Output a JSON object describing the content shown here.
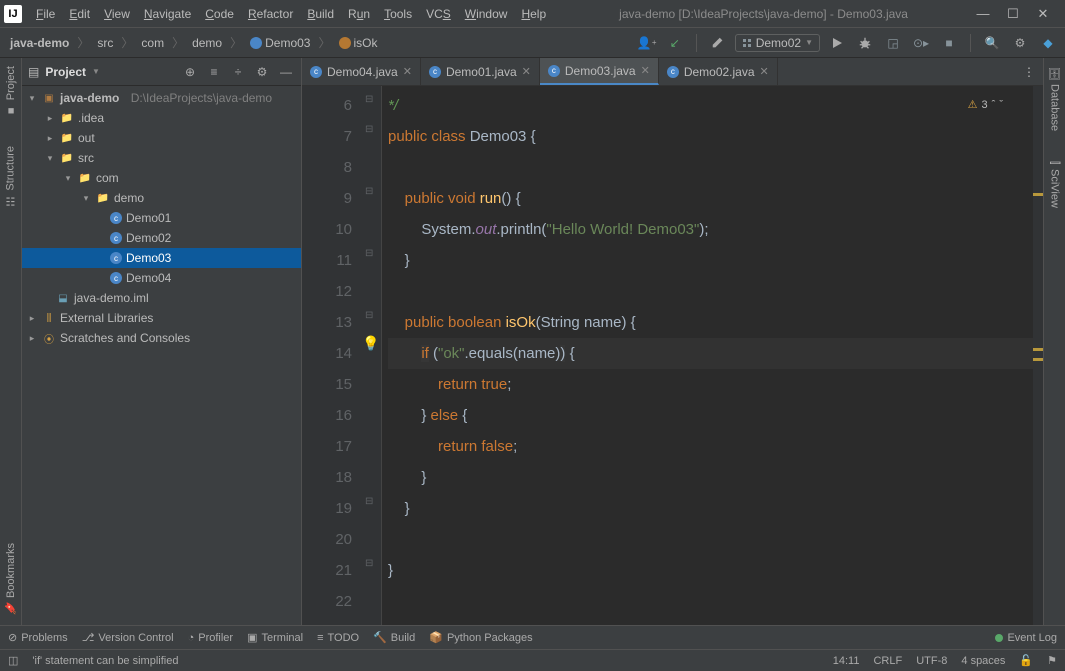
{
  "title": "java-demo [D:\\IdeaProjects\\java-demo] - Demo03.java",
  "menubar": [
    "File",
    "Edit",
    "View",
    "Navigate",
    "Code",
    "Refactor",
    "Build",
    "Run",
    "Tools",
    "VCS",
    "Window",
    "Help"
  ],
  "breadcrumb": {
    "c0": "java-demo",
    "c1": "src",
    "c2": "com",
    "c3": "demo",
    "c4": "Demo03",
    "c5": "isOk"
  },
  "run_config": "Demo02",
  "panel": {
    "title": "Project"
  },
  "tree": {
    "root": "java-demo",
    "root_path": "D:\\IdeaProjects\\java-demo",
    "idea": ".idea",
    "out": "out",
    "src": "src",
    "com": "com",
    "demo": "demo",
    "d1": "Demo01",
    "d2": "Demo02",
    "d3": "Demo03",
    "d4": "Demo04",
    "iml": "java-demo.iml",
    "ext": "External Libraries",
    "scratch": "Scratches and Consoles"
  },
  "tabs": {
    "t0": "Demo04.java",
    "t1": "Demo01.java",
    "t2": "Demo03.java",
    "t3": "Demo02.java"
  },
  "warn_count": "3",
  "code": {
    "l6": "*/",
    "l7_kw1": "public ",
    "l7_kw2": "class ",
    "l7_cls": "Demo03 ",
    "l7_br": "{",
    "l9_kw1": "public ",
    "l9_kw2": "void ",
    "l9_fn": "run",
    "l9_par": "() {",
    "l10_a": "System.",
    "l10_b": "out",
    "l10_c": ".println(",
    "l10_d": "\"Hello World! Demo03\"",
    "l10_e": ");",
    "l11": "}",
    "l13_kw1": "public ",
    "l13_kw2": "boolean ",
    "l13_fn": "isOk",
    "l13_par": "(String name) {",
    "l14_kw": "if",
    "l14_p1": " (",
    "l14_s": "\"ok\"",
    "l14_eq": ".equals(name)",
    "l14_p2": ")",
    "l14_br": " {",
    "l15_kw": "return ",
    "l15_v": "true",
    "l15_s": ";",
    "l16_a": "} ",
    "l16_kw": "else",
    "l16_b": " {",
    "l17_kw": "return ",
    "l17_v": "false",
    "l17_s": ";",
    "l18": "}",
    "l19": "}",
    "l21": "}"
  },
  "lines": [
    "6",
    "7",
    "8",
    "9",
    "10",
    "11",
    "12",
    "13",
    "14",
    "15",
    "16",
    "17",
    "18",
    "19",
    "20",
    "21",
    "22"
  ],
  "toolwindows": {
    "problems": "Problems",
    "vcs": "Version Control",
    "profiler": "Profiler",
    "terminal": "Terminal",
    "todo": "TODO",
    "build": "Build",
    "python": "Python Packages",
    "eventlog": "Event Log"
  },
  "status": {
    "msg": "'if' statement can be simplified",
    "pos": "14:11",
    "le": "CRLF",
    "enc": "UTF-8",
    "indent": "4 spaces"
  },
  "sidebars": {
    "project": "Project",
    "structure": "Structure",
    "bookmarks": "Bookmarks",
    "database": "Database",
    "sciview": "SciView"
  }
}
